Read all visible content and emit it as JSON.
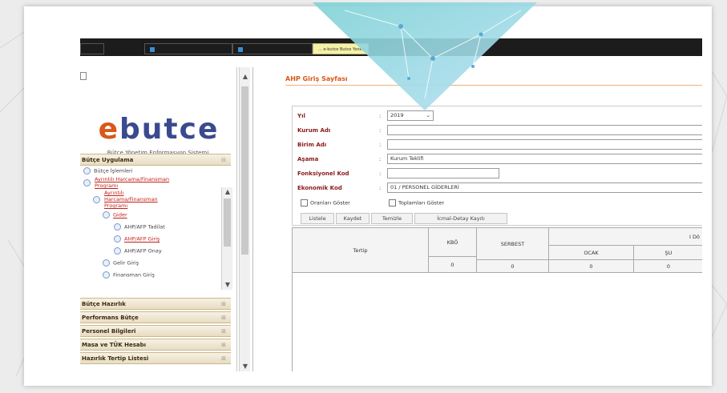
{
  "taskbar": {
    "items": [
      {
        "label": ""
      },
      {
        "label": ""
      },
      {
        "label": ""
      },
      {
        "label": "... e-butce Butce Yoneti..."
      }
    ]
  },
  "sidebar": {
    "logo": "ebutce",
    "logo_sub": "Bütçe Yönetim Enformasyon Sistemi",
    "sections_top": [
      {
        "label": "Bütçe Uygulama"
      }
    ],
    "tree": [
      {
        "label": "Bütçe İşlemleri",
        "link": false
      },
      {
        "label": "Ayrıntılı Harcama/Finansman",
        "link": true
      },
      {
        "label": "Programı",
        "link": true
      },
      {
        "label": "Ayrıntılı",
        "link": true
      },
      {
        "label": "Harcama/Finansman",
        "link": true
      },
      {
        "label": "Programı",
        "link": true
      },
      {
        "label": "Gider",
        "link": true
      },
      {
        "label": "AHP/AFP Tadilat",
        "link": false
      },
      {
        "label": "AHP/AFP Giriş",
        "link": true
      },
      {
        "label": "AHP/AFP Onay",
        "link": false
      },
      {
        "label": "Gelir Giriş",
        "link": false
      },
      {
        "label": "Finansman Giriş",
        "link": false
      }
    ],
    "sections_bottom": [
      {
        "label": "Bütçe Hazırlık"
      },
      {
        "label": "Performans Bütçe"
      },
      {
        "label": "Personel Bilgileri"
      },
      {
        "label": "Masa ve TÜK Hesabı"
      },
      {
        "label": "Hazırlık Tertip Listesi"
      }
    ]
  },
  "main": {
    "title": "AHP Giriş Sayfası",
    "form": {
      "yil_label": "Yıl",
      "yil_value": "2019",
      "kurum_label": "Kurum Adı",
      "kurum_value": "",
      "birim_label": "Birim Adı",
      "birim_value": "",
      "asama_label": "Aşama",
      "asama_value": "Kurum Teklifi",
      "fonk_label": "Fonksiyonel Kod",
      "fonk_value": "",
      "eko_label": "Ekonomik Kod",
      "eko_value": "01 / PERSONEL GİDERLERİ"
    },
    "checkboxes": {
      "oranlari": "Oranları Göster",
      "toplamlari": "Toplamları Göster"
    },
    "buttons": {
      "listele": "Listele",
      "kaydet": "Kaydet",
      "temizle": "Temizle",
      "icmal": "İcmal-Detay Kayıtı"
    },
    "grid": {
      "tertip": "Tertip",
      "kbo": "KBÖ",
      "serbest": "SERBEST",
      "donem": "I Dö",
      "ocak": "OCAK",
      "subat": "ŞU",
      "v_kbo": "0",
      "v_serbest": "0",
      "v_ocak": "0",
      "v_subat": "0"
    }
  }
}
